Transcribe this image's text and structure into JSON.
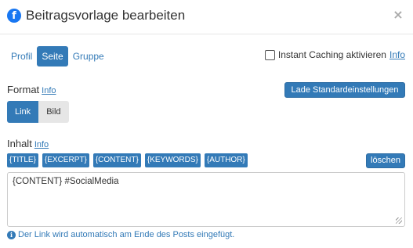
{
  "dialog": {
    "title": "Beitragsvorlage bearbeiten",
    "icon": "facebook-icon",
    "close_symbol": "×"
  },
  "tabs": [
    {
      "label": "Profil",
      "active": false
    },
    {
      "label": "Seite",
      "active": true
    },
    {
      "label": "Gruppe",
      "active": false
    }
  ],
  "instant_caching": {
    "label": "Instant Caching aktivieren",
    "checked": false,
    "info_link": "Info"
  },
  "format": {
    "label": "Format",
    "info_link": "Info",
    "reset_button": "Lade Standardeinstellungen",
    "options": [
      {
        "label": "Link",
        "active": true
      },
      {
        "label": "Bild",
        "active": false
      }
    ]
  },
  "content": {
    "label": "Inhalt",
    "info_link": "Info",
    "placeholders": [
      "{TITLE}",
      "{EXCERPT}",
      "{CONTENT}",
      "{KEYWORDS}",
      "{AUTHOR}"
    ],
    "clear_button": "löschen",
    "value": "{CONTENT} #SocialMedia",
    "hint": "Der Link wird automatisch am Ende des Posts eingefügt."
  },
  "colors": {
    "primary": "#337ab7",
    "facebook": "#1877f2",
    "secondary_button": "#e6e6e6"
  }
}
